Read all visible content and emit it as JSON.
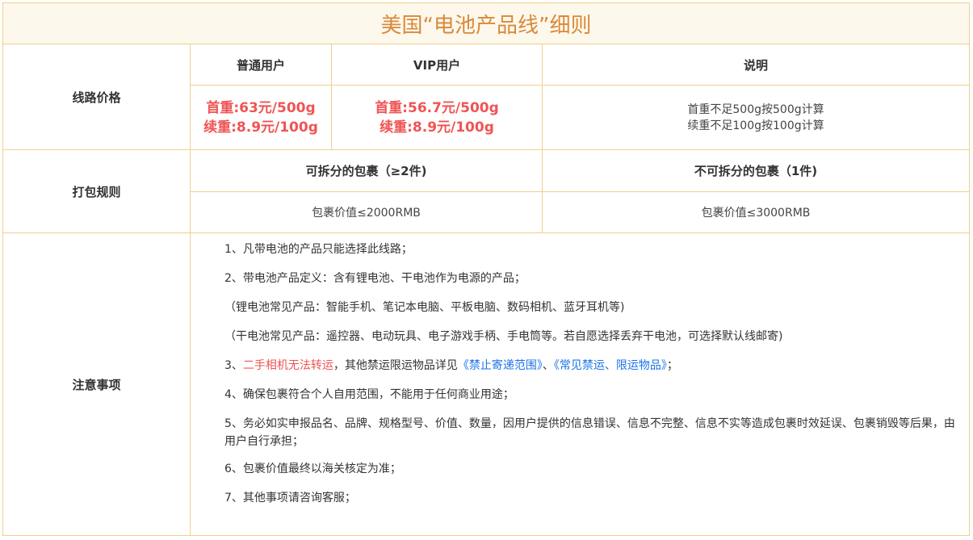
{
  "title": "美国“电池产品线”细则",
  "pricing": {
    "label": "线路价格",
    "headers": [
      "普通用户",
      "VIP用户",
      "说明"
    ],
    "regular": {
      "first": "首重:63元/500g",
      "extra": "续重:8.9元/100g"
    },
    "vip": {
      "first": "首重:56.7元/500g",
      "extra": "续重:8.9元/100g"
    },
    "explain": {
      "line1": "首重不足500g按500g计算",
      "line2": "续重不足100g按100g计算"
    }
  },
  "packing": {
    "label": "打包规则",
    "headers": [
      "可拆分的包裹（≥2件)",
      "不可拆分的包裹（1件)"
    ],
    "values": [
      "包裹价值≤2000RMB",
      "包裹价值≤3000RMB"
    ]
  },
  "notes": {
    "label": "注意事项",
    "item1": "1、凡带电池的产品只能选择此线路；",
    "item2": "2、带电池产品定义：含有锂电池、干电池作为电源的产品；",
    "item2a": "（锂电池常见产品：智能手机、笔记本电脑、平板电脑、数码相机、蓝牙耳机等)",
    "item2b": "（干电池常见产品：遥控器、电动玩具、电子游戏手柄、手电筒等。若自愿选择丢弃干电池，可选择默认线邮寄)",
    "item3_prefix": "3、",
    "item3_red": "二手相机无法转运",
    "item3_mid": "，其他禁运限运物品详见",
    "item3_link1": "《禁止寄递范围》",
    "item3_sep": "、",
    "item3_link2": "《常见禁运、限运物品》",
    "item3_end": "；",
    "item4": "4、确保包裹符合个人自用范围，不能用于任何商业用途；",
    "item5": "5、务必如实申报品名、品牌、规格型号、价值、数量，因用户提供的信息错误、信息不完整、信息不实等造成包裹时效延误、包裹销毁等后果，由用户自行承担；",
    "item6": "6、包裹价值最终以海关核定为准；",
    "item7": "7、其他事项请咨询客服；"
  },
  "colors": {
    "border": "#f0cf8e",
    "title_bg": "#fdf8ec",
    "title_text": "#d9893a",
    "price": "#f05454",
    "link": "#1a73e8"
  }
}
